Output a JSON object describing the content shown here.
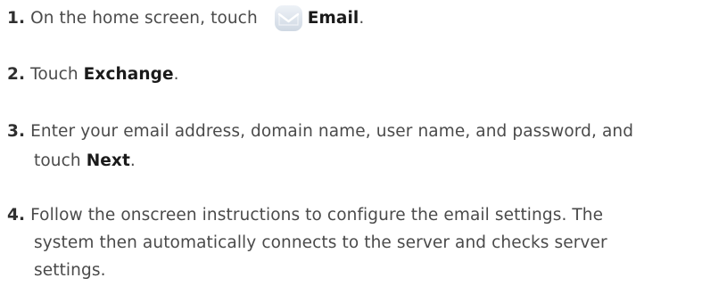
{
  "steps": [
    {
      "number": "1.",
      "text_before": " On the home screen, touch ",
      "icon": "email-app-icon",
      "bold": "Email",
      "text_after": "."
    },
    {
      "number": "2.",
      "text_before": " Touch ",
      "bold": "Exchange",
      "text_after": "."
    },
    {
      "number": "3.",
      "line1": " Enter your email address, domain name, user name, and password, and",
      "line2_before": "touch ",
      "bold": "Next",
      "text_after": "."
    },
    {
      "number": "4.",
      "line1": " Follow the onscreen instructions to configure the email settings. The",
      "line2": "system then automatically connects to the server and checks server",
      "line3": "settings."
    }
  ],
  "colors": {
    "text": "#4a4a4a",
    "bold": "#1a1a1a",
    "icon_bg": "#dfe6ef",
    "icon_envelope": "#ffffff"
  }
}
